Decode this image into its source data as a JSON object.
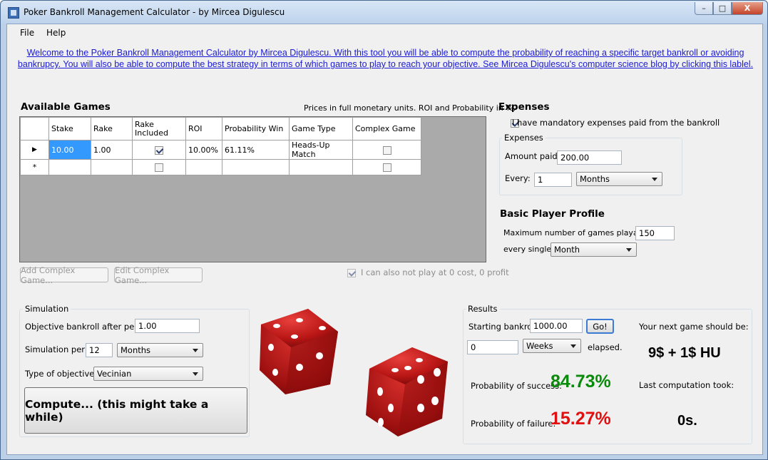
{
  "window": {
    "title": "Poker Bankroll Management Calculator - by Mircea Digulescu",
    "minimize": "–",
    "maximize": "□",
    "close": "X"
  },
  "menu": {
    "file": "File",
    "help": "Help"
  },
  "welcome_text": "Welcome to the Poker Bankroll Management Calculator by Mircea Digulescu. With this tool you will be able to compute the probability of reaching a specific target bankroll or avoiding bankrupcy. You will also be able to compute the best strategy in terms of which games to play to reach your objective.  See Mircea Digulescu's computer science blog by clicking this lablel.",
  "games": {
    "heading": "Available Games",
    "note": "Prices in full monetary units. ROI and Probability in %.",
    "columns": [
      "Stake",
      "Rake",
      "Rake Included",
      "ROI",
      "Probability Win",
      "Game Type",
      "Complex Game"
    ],
    "rows": [
      {
        "marker": "▶",
        "stake": "10.00",
        "rake": "1.00",
        "rake_included": true,
        "roi": "10.00%",
        "prob_win": "61.11%",
        "game_type": "Heads-Up Match",
        "complex": false
      }
    ],
    "new_row_marker": "*",
    "add_complex": "Add Complex Game...",
    "edit_complex": "Edit Complex Game...",
    "zero_cost_label": "I can also not play at 0 cost, 0 profit"
  },
  "expenses": {
    "heading": "Expenses",
    "checkbox_label": "I have mandatory expenses paid from the bankroll",
    "group_title": "Expenses",
    "amount_label": "Amount paid:",
    "amount_value": "200.00",
    "every_label": "Every:",
    "every_value": "1",
    "every_unit": "Months"
  },
  "profile": {
    "heading": "Basic Player Profile",
    "max_games_label": "Maximum number of games playable:",
    "max_games_value": "150",
    "every_single_label": "every single",
    "every_single_unit": "Month"
  },
  "simulation": {
    "group_title": "Simulation",
    "objective_label": "Objective bankroll after period:",
    "objective_value": "1.00",
    "period_label": "Simulation period:",
    "period_value": "12",
    "period_unit": "Months",
    "type_label": "Type of objective:",
    "type_value": "Vecinian",
    "compute_button": "Compute... (this might take a while)"
  },
  "results": {
    "group_title": "Results",
    "starting_label": "Starting bankroll:",
    "starting_value": "1000.00",
    "go_button": "Go!",
    "elapsed_value": "0",
    "elapsed_unit": "Weeks",
    "elapsed_label": "elapsed.",
    "next_game_label": "Your next game should be:",
    "next_game_value": "9$ + 1$ HU",
    "success_label": "Probability of success:",
    "success_value": "84.73%",
    "failure_label": "Probability of failure:",
    "failure_value": "15.27%",
    "last_computation_label": "Last computation took:",
    "last_computation_value": "0s.",
    "colors": {
      "success": "#0a8a0a",
      "failure": "#e01010"
    }
  }
}
